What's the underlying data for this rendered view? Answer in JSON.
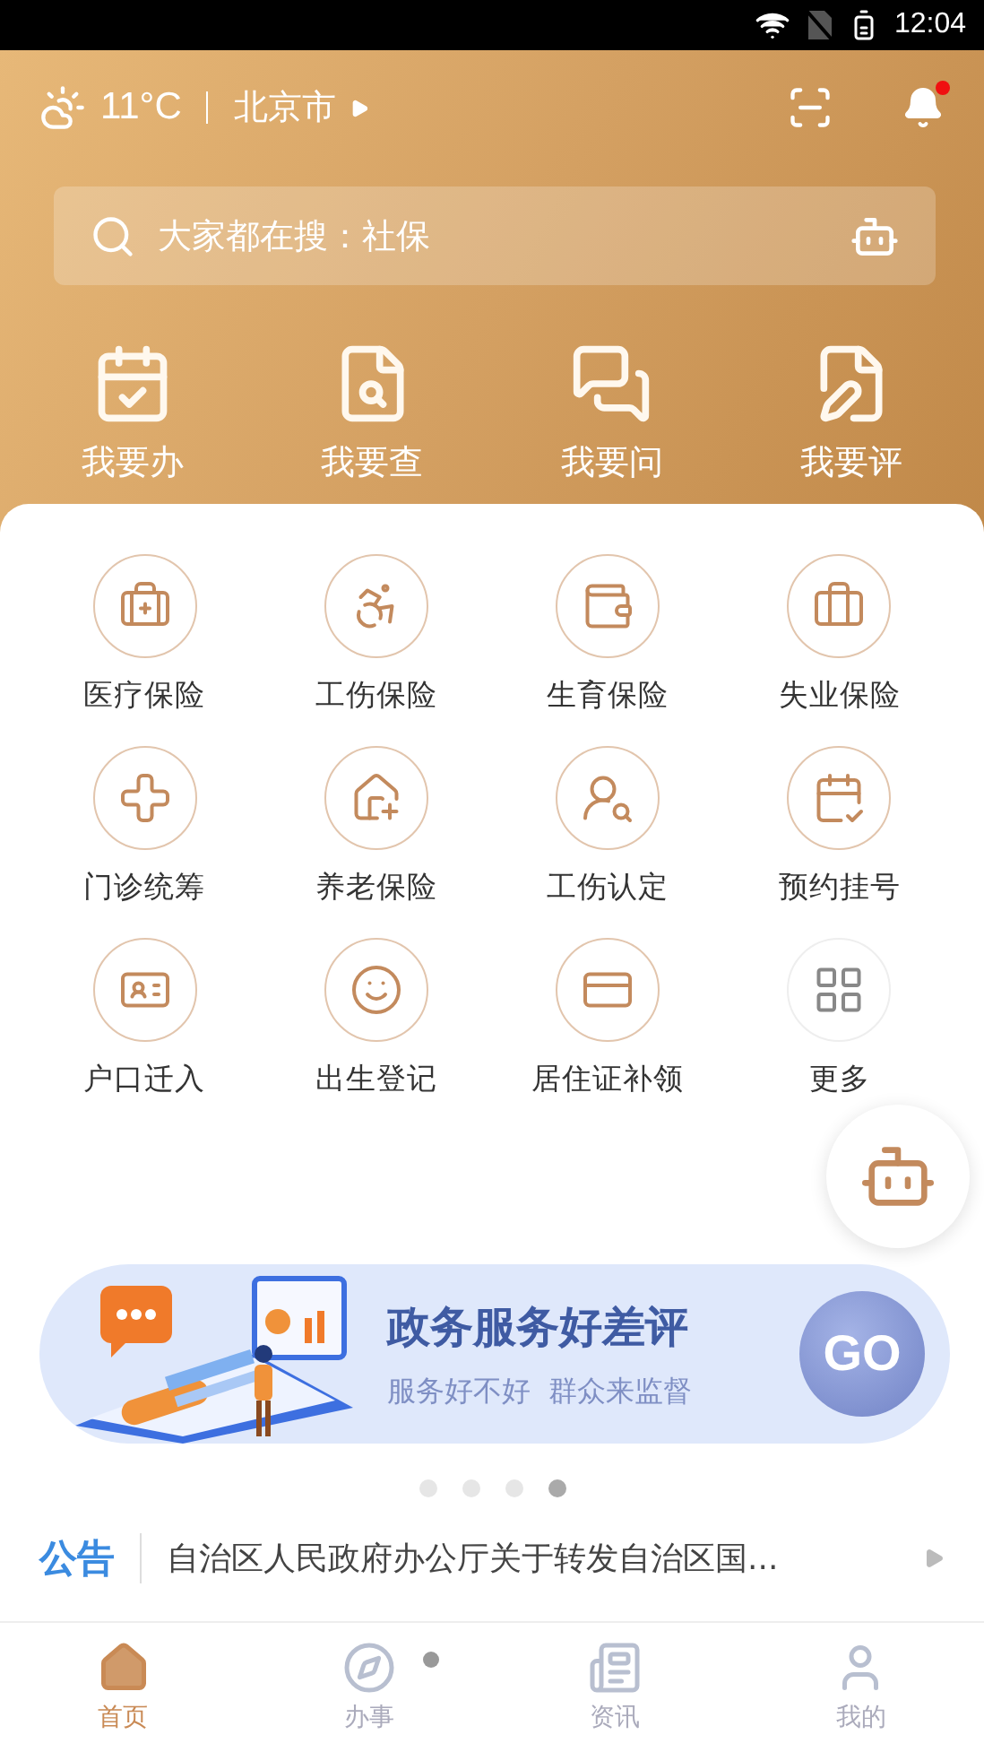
{
  "status_bar": {
    "time": "12:04"
  },
  "header": {
    "temperature": "11°C",
    "city": "北京市",
    "notification": true
  },
  "search": {
    "placeholder": "大家都在搜：社保"
  },
  "quick_actions": [
    {
      "label": "我要办"
    },
    {
      "label": "我要查"
    },
    {
      "label": "我要问"
    },
    {
      "label": "我要评"
    }
  ],
  "services": [
    {
      "label": "医疗保险",
      "kind": "service"
    },
    {
      "label": "工伤保险",
      "kind": "service"
    },
    {
      "label": "生育保险",
      "kind": "service"
    },
    {
      "label": "失业保险",
      "kind": "service"
    },
    {
      "label": "门诊统筹",
      "kind": "service"
    },
    {
      "label": "养老保险",
      "kind": "service"
    },
    {
      "label": "工伤认定",
      "kind": "service"
    },
    {
      "label": "预约挂号",
      "kind": "service"
    },
    {
      "label": "户口迁入",
      "kind": "service"
    },
    {
      "label": "出生登记",
      "kind": "service"
    },
    {
      "label": "居住证补领",
      "kind": "service"
    },
    {
      "label": "更多",
      "kind": "more"
    }
  ],
  "banner": {
    "title": "政务服务好差评",
    "subtitle": "服务好不好  群众来监督",
    "button": "GO"
  },
  "carousel_dots": [
    {
      "selected": false
    },
    {
      "selected": false
    },
    {
      "selected": false
    },
    {
      "selected": true
    }
  ],
  "notice": {
    "tag": "公告",
    "text": "自治区人民政府办公厅关于转发自治区国..."
  },
  "tabs": [
    {
      "label": "首页",
      "selected": true,
      "dot": false
    },
    {
      "label": "办事",
      "selected": false,
      "dot": true
    },
    {
      "label": "资讯",
      "selected": false,
      "dot": false
    },
    {
      "label": "我的",
      "selected": false,
      "dot": false
    }
  ]
}
